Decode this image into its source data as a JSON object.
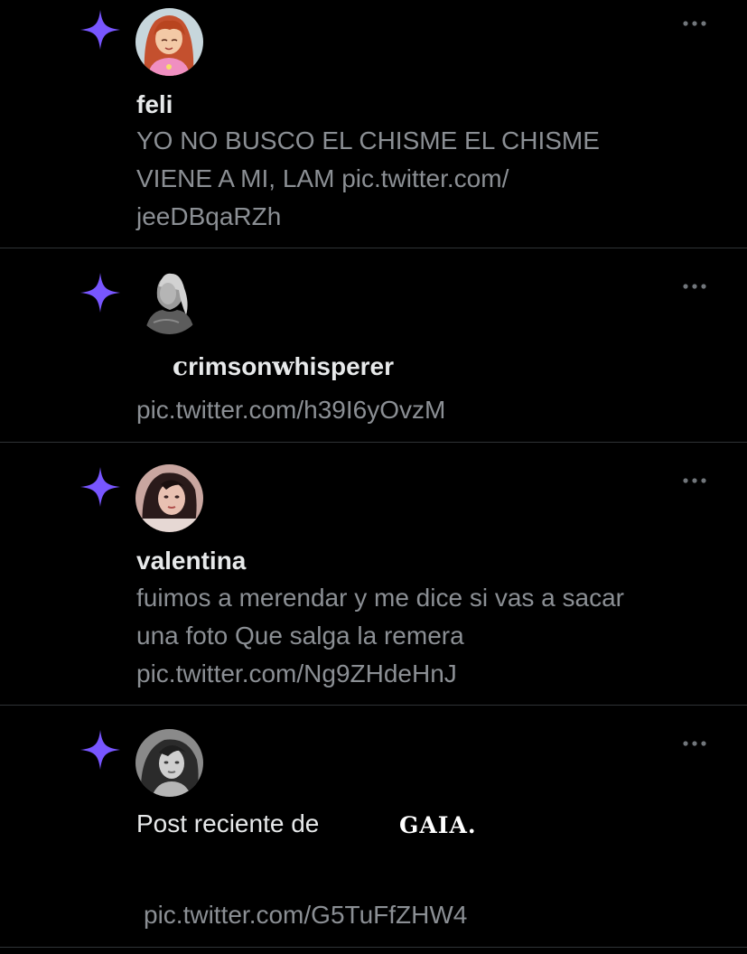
{
  "accent_color": "#7856ff",
  "posts": [
    {
      "icon": "sparkle-icon",
      "avatar": "cartoon-avatar",
      "name": "feli",
      "text_line1": "YO NO BUSCO EL CHISME EL CHISME",
      "text_line2": "VIENE A MI, LAM ",
      "link_part1": "pic.twitter.com/",
      "link_part2": "jeeDBqaRZh"
    },
    {
      "icon": "sparkle-icon",
      "avatar": "grayscale-portrait-avatar",
      "name_prefix": "c",
      "name_mid": "rimson",
      "name_gothic": "w",
      "name_suffix": "hisperer",
      "link": "pic.twitter.com/h39I6yOvzM"
    },
    {
      "icon": "sparkle-icon",
      "avatar": "photo-avatar",
      "name": "valentina",
      "text_line1": "fuimos a merendar y me dice si vas a sacar",
      "text_line2": "una foto Que salga la remera",
      "link": "pic.twitter.com/Ng9ZHdeHnJ"
    },
    {
      "icon": "sparkle-icon",
      "avatar": "grayscale-photo-avatar",
      "label": "Post reciente de",
      "name": "GAIA.",
      "link": "pic.twitter.com/G5TuFfZHW4"
    }
  ]
}
